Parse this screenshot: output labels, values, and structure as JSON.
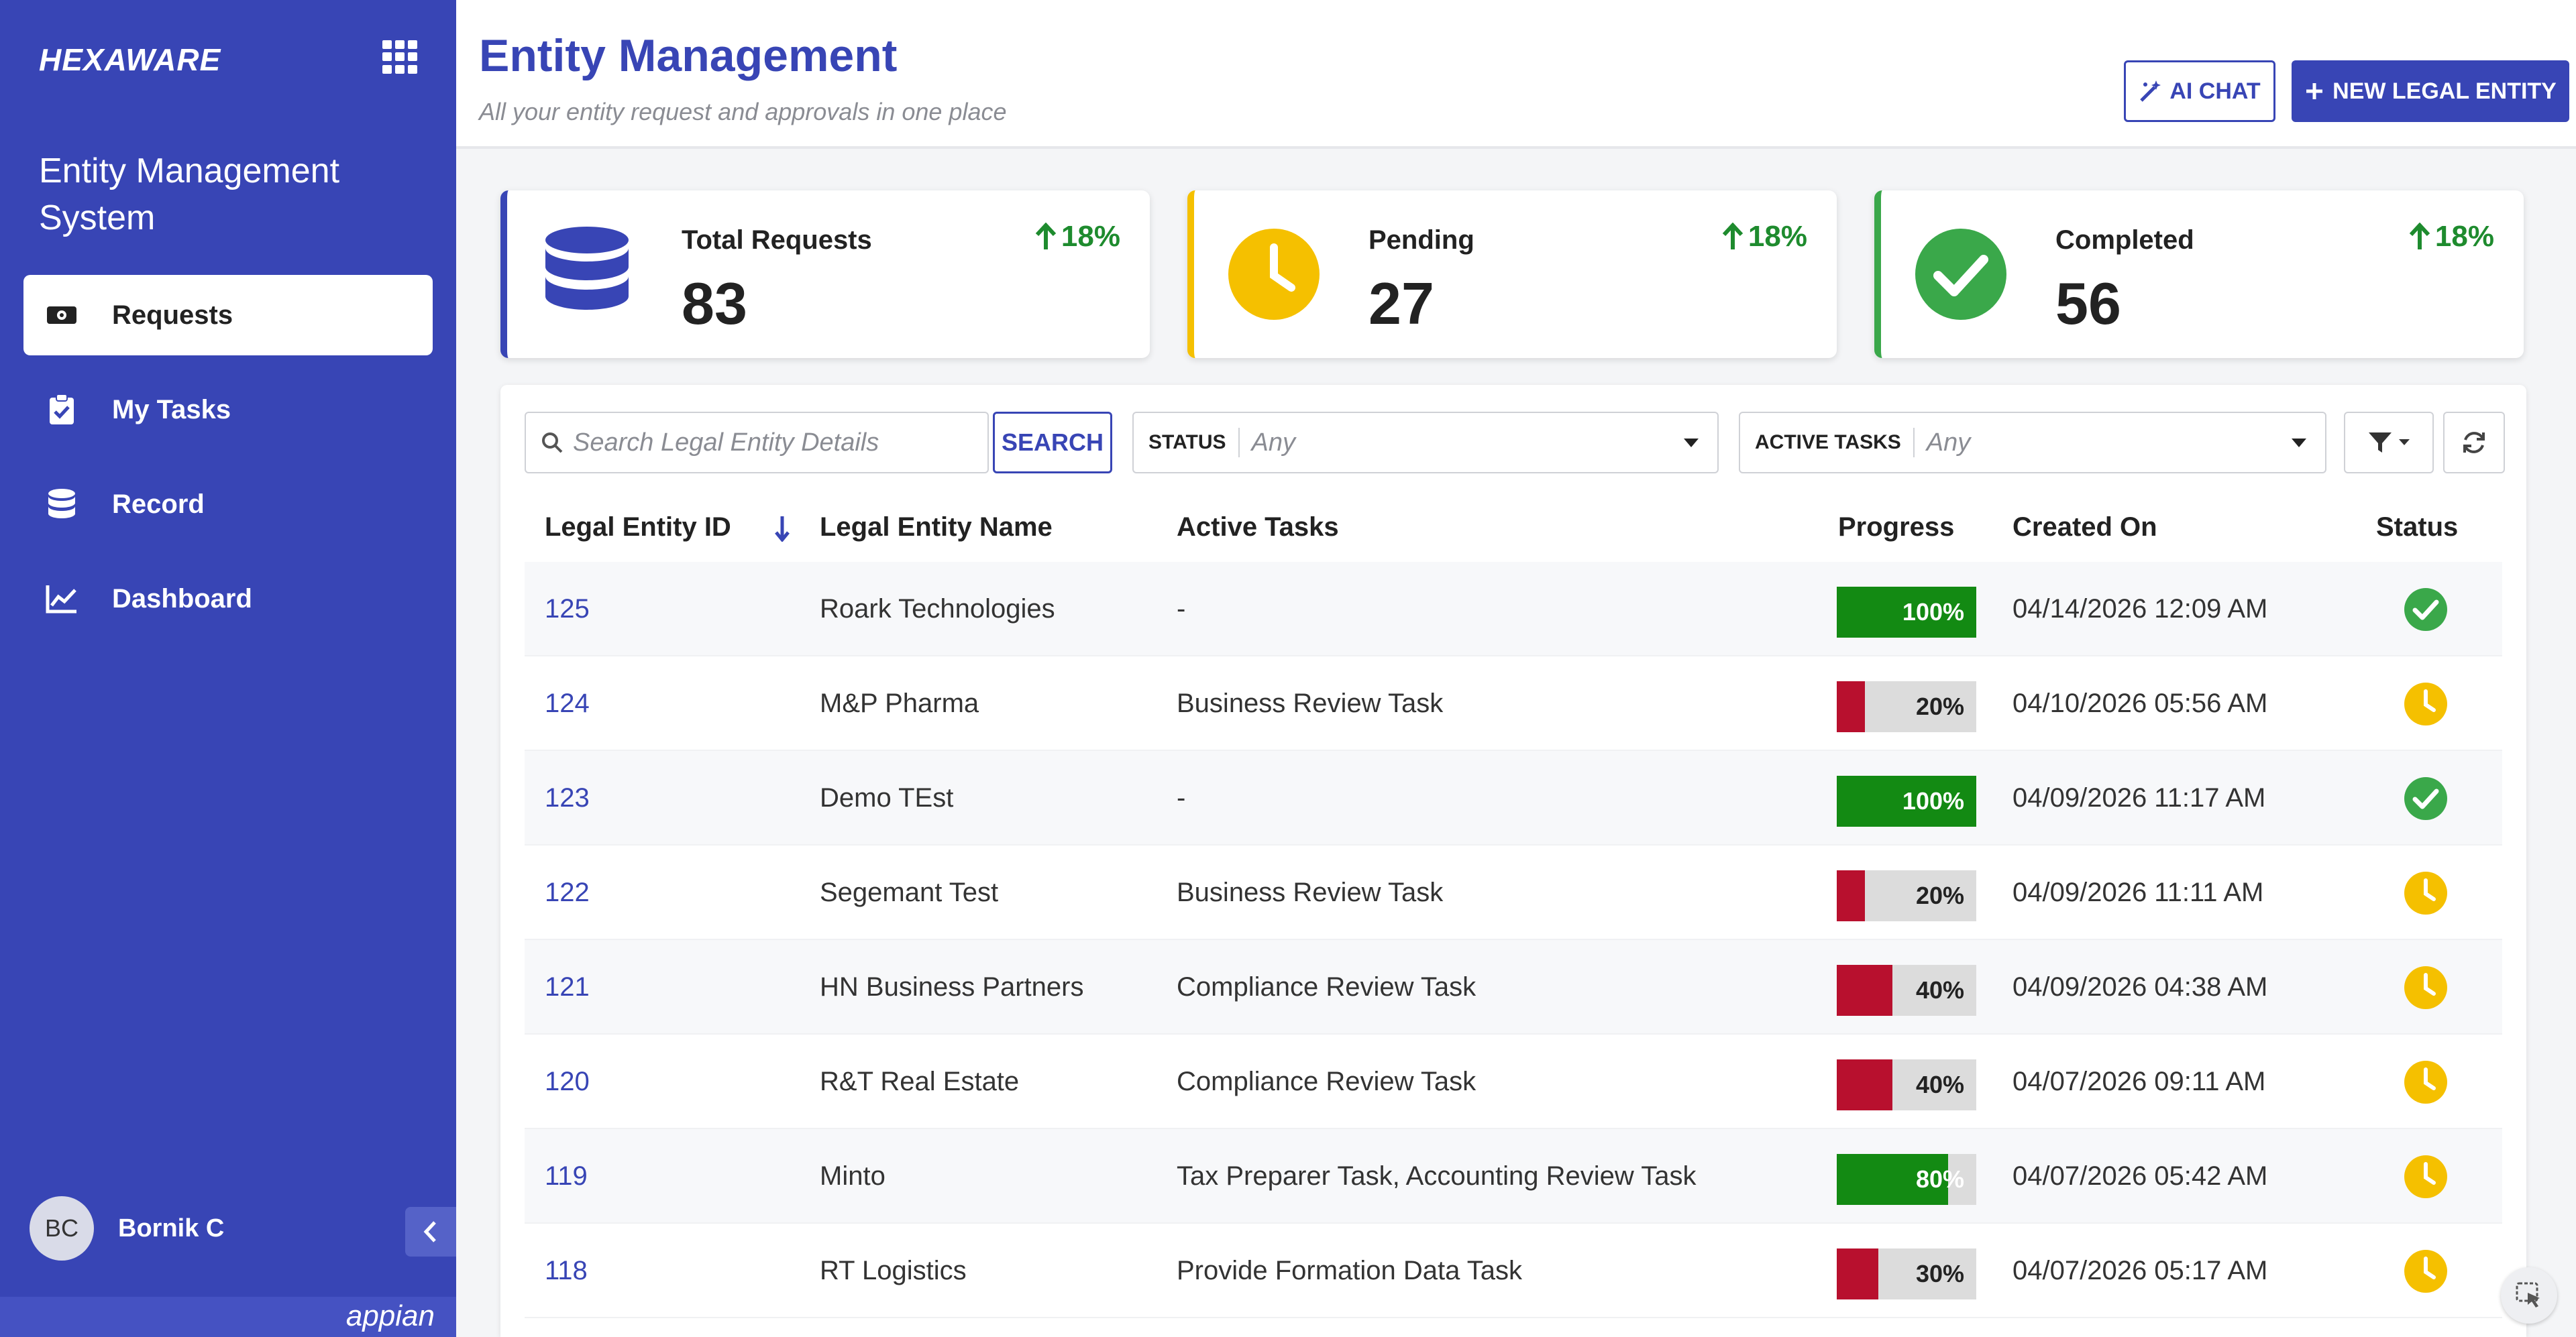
{
  "sidebar": {
    "brand": "HEXAWARE",
    "system_title": "Entity Management System",
    "items": [
      {
        "label": "Requests",
        "icon": "requests-icon",
        "active": true
      },
      {
        "label": "My Tasks",
        "icon": "clipboard-check-icon",
        "active": false
      },
      {
        "label": "Record",
        "icon": "database-icon",
        "active": false
      },
      {
        "label": "Dashboard",
        "icon": "chart-line-icon",
        "active": false
      }
    ],
    "user": {
      "initials": "BC",
      "name": "Bornik C"
    },
    "footer_logo": "appian"
  },
  "header": {
    "title": "Entity Management",
    "subtitle": "All your entity request and approvals in one place",
    "ai_chat_label": "AI CHAT",
    "new_entity_label": "NEW LEGAL ENTITY"
  },
  "kpis": [
    {
      "label": "Total Requests",
      "value": "83",
      "change": "18%",
      "color": "#3845b5",
      "icon": "database-icon"
    },
    {
      "label": "Pending",
      "value": "27",
      "change": "18%",
      "color": "#f5c000",
      "icon": "clock-icon"
    },
    {
      "label": "Completed",
      "value": "56",
      "change": "18%",
      "color": "#3aa84a",
      "icon": "check-circle-icon"
    }
  ],
  "filters": {
    "search_placeholder": "Search Legal Entity Details",
    "search_button": "SEARCH",
    "status_label": "STATUS",
    "status_value": "Any",
    "active_tasks_label": "ACTIVE TASKS",
    "active_tasks_value": "Any"
  },
  "table": {
    "columns": [
      "Legal Entity ID",
      "Legal Entity Name",
      "Active Tasks",
      "Progress",
      "Created On",
      "Status"
    ],
    "rows": [
      {
        "id": "125",
        "name": "Roark Technologies",
        "tasks": "-",
        "progress": 100,
        "progress_label": "100%",
        "created": "04/14/2026 12:09 AM",
        "status": "completed"
      },
      {
        "id": "124",
        "name": "M&P Pharma",
        "tasks": "Business Review Task",
        "progress": 20,
        "progress_label": "20%",
        "created": "04/10/2026 05:56 AM",
        "status": "pending"
      },
      {
        "id": "123",
        "name": "Demo TEst",
        "tasks": "-",
        "progress": 100,
        "progress_label": "100%",
        "created": "04/09/2026 11:17 AM",
        "status": "completed"
      },
      {
        "id": "122",
        "name": "Segemant Test",
        "tasks": "Business Review Task",
        "progress": 20,
        "progress_label": "20%",
        "created": "04/09/2026 11:11 AM",
        "status": "pending"
      },
      {
        "id": "121",
        "name": "HN Business Partners",
        "tasks": "Compliance Review Task",
        "progress": 40,
        "progress_label": "40%",
        "created": "04/09/2026 04:38 AM",
        "status": "pending"
      },
      {
        "id": "120",
        "name": "R&T Real Estate",
        "tasks": "Compliance Review Task",
        "progress": 40,
        "progress_label": "40%",
        "created": "04/07/2026 09:11 AM",
        "status": "pending"
      },
      {
        "id": "119",
        "name": "Minto",
        "tasks": "Tax Preparer Task, Accounting Review Task",
        "progress": 80,
        "progress_label": "80%",
        "created": "04/07/2026 05:42 AM",
        "status": "pending"
      },
      {
        "id": "118",
        "name": "RT Logistics",
        "tasks": "Provide Formation Data Task",
        "progress": 30,
        "progress_label": "30%",
        "created": "04/07/2026 05:17 AM",
        "status": "pending"
      }
    ]
  },
  "colors": {
    "primary": "#3845b5",
    "progress_complete": "#138a13",
    "progress_low": "#b8102e",
    "pending": "#f5c000",
    "completed": "#3aa84a",
    "trend_up": "#1e8b2e"
  }
}
